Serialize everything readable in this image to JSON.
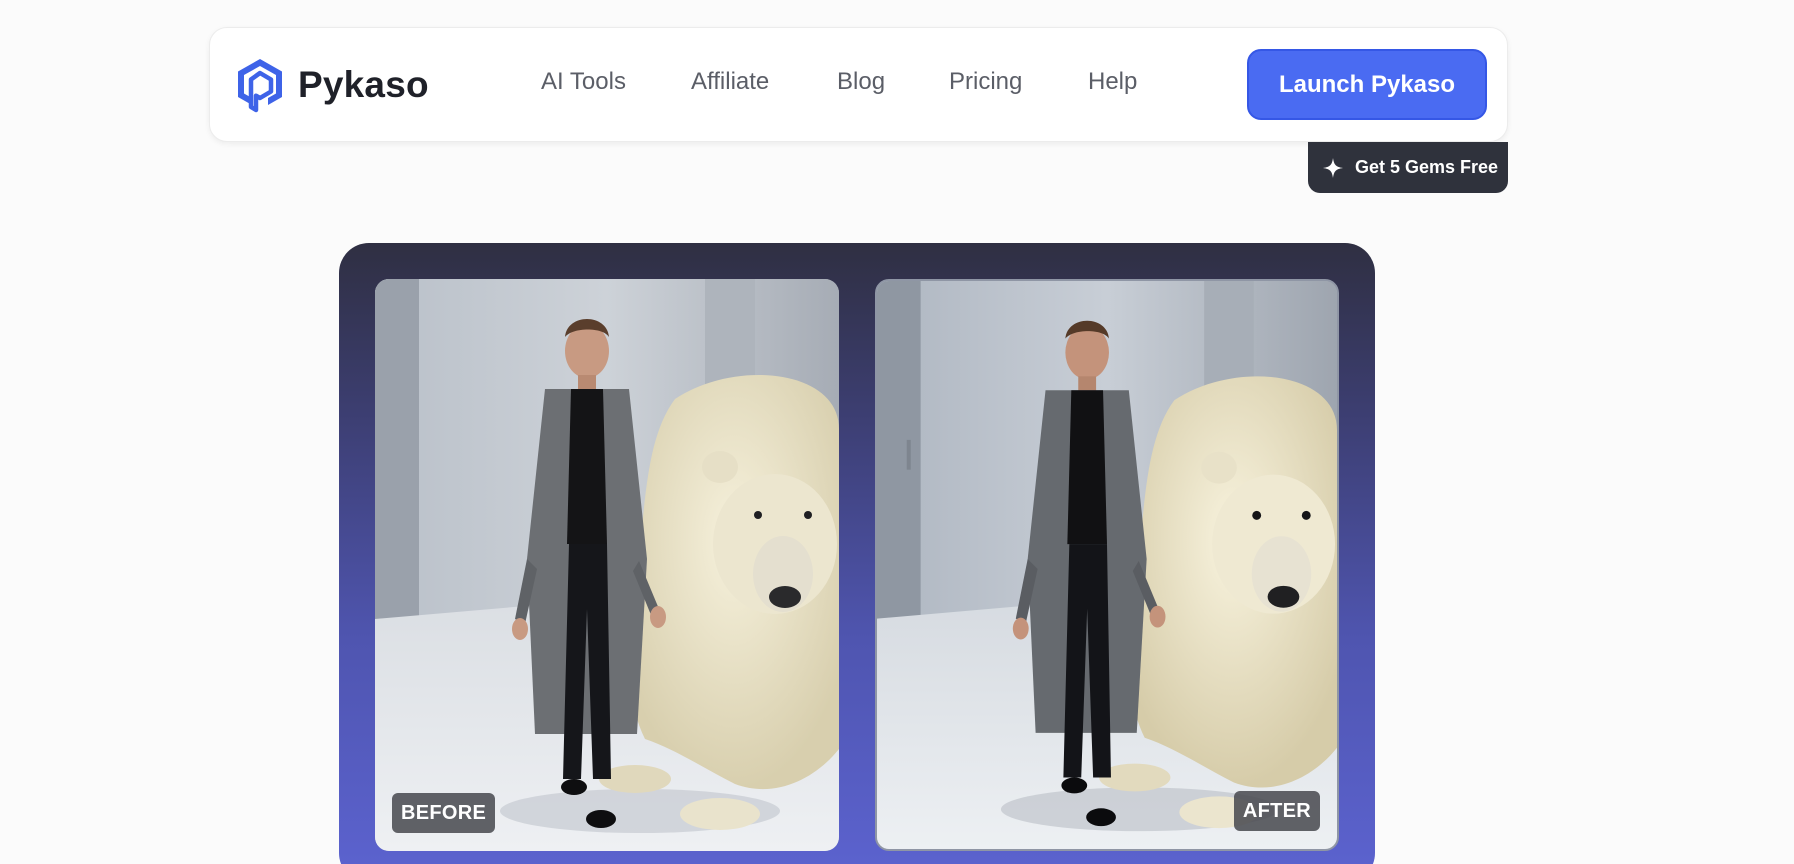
{
  "brand": {
    "name": "Pykaso",
    "logo_icon": "hexagon-p-logo-icon",
    "accent": "#4a6bf2"
  },
  "nav": {
    "links": [
      "AI Tools",
      "Affiliate",
      "Blog",
      "Pricing",
      "Help"
    ],
    "cta_label": "Launch Pykaso"
  },
  "promo": {
    "icon": "sparkle-icon",
    "label": "Get 5 Gems Free"
  },
  "comparison": {
    "before_label": "BEFORE",
    "after_label": "AFTER"
  }
}
